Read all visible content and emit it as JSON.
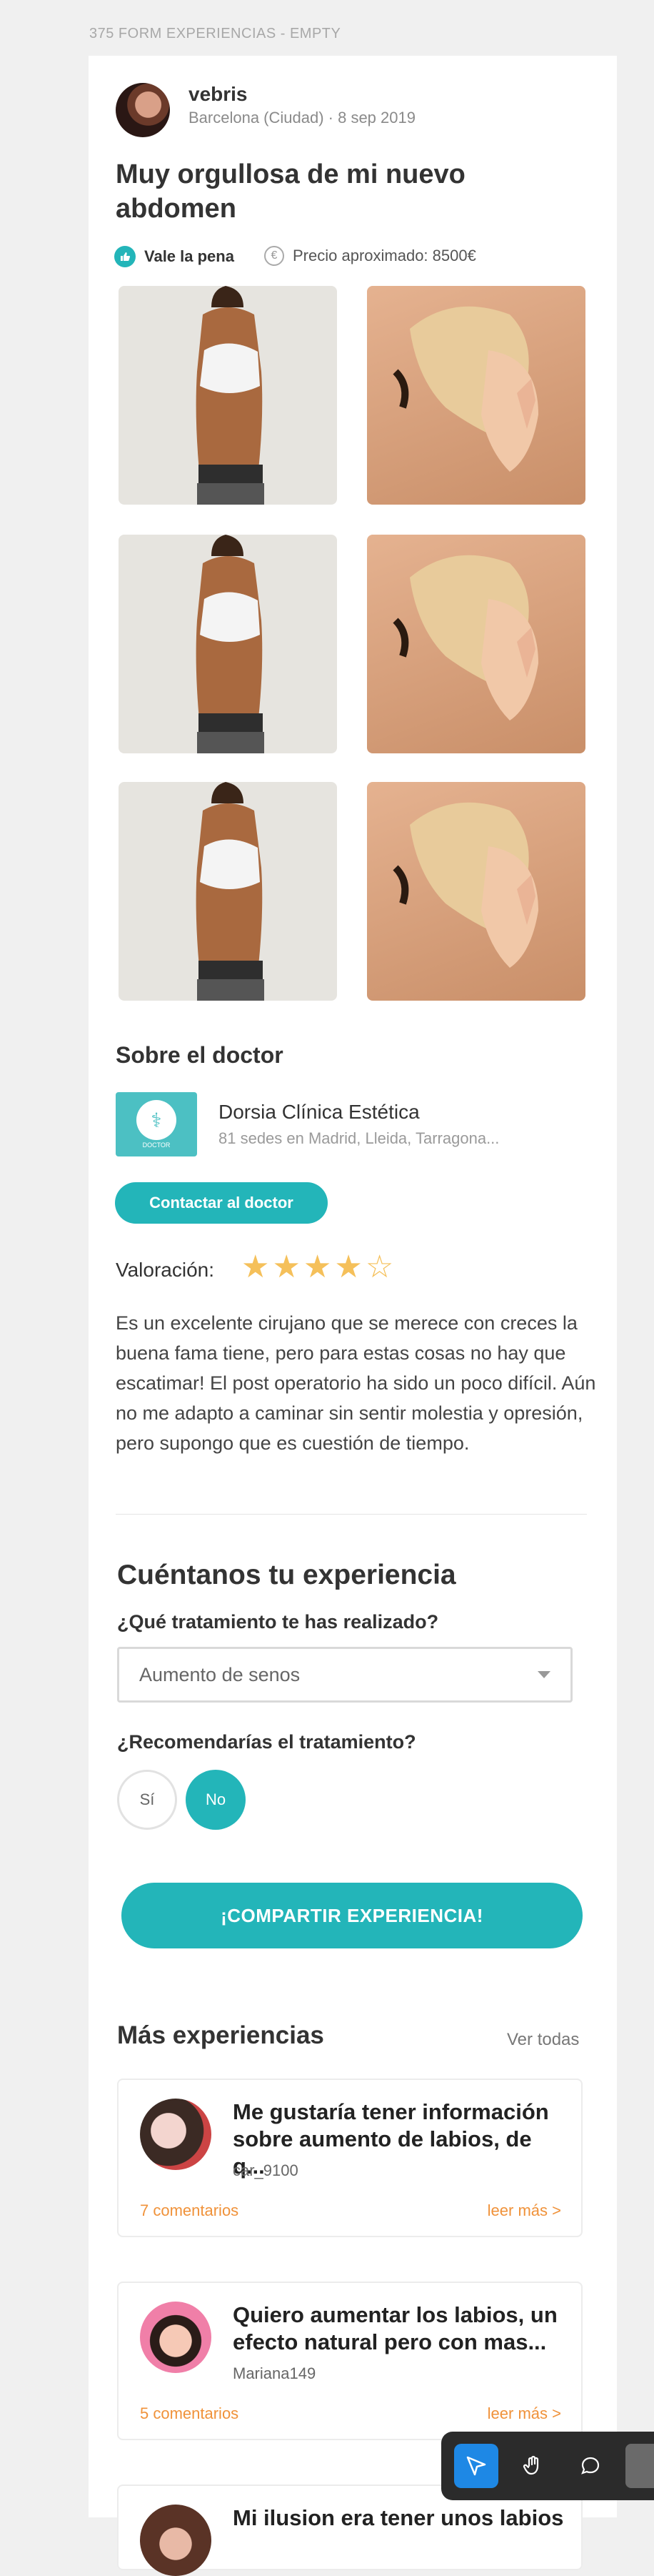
{
  "frame_label": "375 FORM EXPERIENCIAS - EMPTY",
  "post": {
    "author": "vebris",
    "meta": "Barcelona (Ciudad) · 8 sep 2019",
    "title": "Muy orgullosa de mi nuevo abdomen",
    "worth_label": "Vale la pena",
    "price_label": "Precio aproximado: 8500€",
    "icons": {
      "worth": "thumbs-up-icon",
      "price": "euro-icon"
    }
  },
  "doctor": {
    "section_title": "Sobre el doctor",
    "logo_text": "DOCTOR",
    "name": "Dorsia Clínica Estética",
    "locations": "81 sedes en Madrid, Lleida, Tarragona...",
    "contact_label": "Contactar al doctor",
    "rating_label": "Valoración:",
    "rating_value": 4,
    "rating_max": 5,
    "review": "Es un excelente cirujano que se merece con creces la buena fama tiene, pero para estas cosas no hay que escatimar! El post operatorio ha sido un poco difícil. Aún no me adapto a caminar sin sentir molestia y opresión, pero supongo que es cuestión de tiempo."
  },
  "form": {
    "title": "Cuéntanos tu experiencia",
    "q_treatment": "¿Qué tratamiento te has realizado?",
    "treatment_value": "Aumento de senos",
    "q_recommend": "¿Recomendarías el tratamiento?",
    "option_yes": "Sí",
    "option_no": "No",
    "selected": "No",
    "share_label": "¡COMPARTIR EXPERIENCIA!"
  },
  "more": {
    "title": "Más experiencias",
    "see_all": "Ver todas",
    "items": [
      {
        "title": "Me gustaría tener información sobre aumento de labios, de q...",
        "user": "car_9100",
        "comments": "7 comentarios",
        "more": "leer más >"
      },
      {
        "title": "Quiero aumentar los labios, un efecto  natural pero con mas...",
        "user": "Mariana149",
        "comments": "5 comentarios",
        "more": "leer más >"
      },
      {
        "title": "Mi ilusion era tener unos labios"
      }
    ]
  },
  "toolbar": {
    "tools": [
      "pointer-icon",
      "hand-icon",
      "comment-icon"
    ]
  },
  "colors": {
    "accent": "#23b5b9",
    "link": "#f0923a",
    "star": "#f5c05a"
  }
}
